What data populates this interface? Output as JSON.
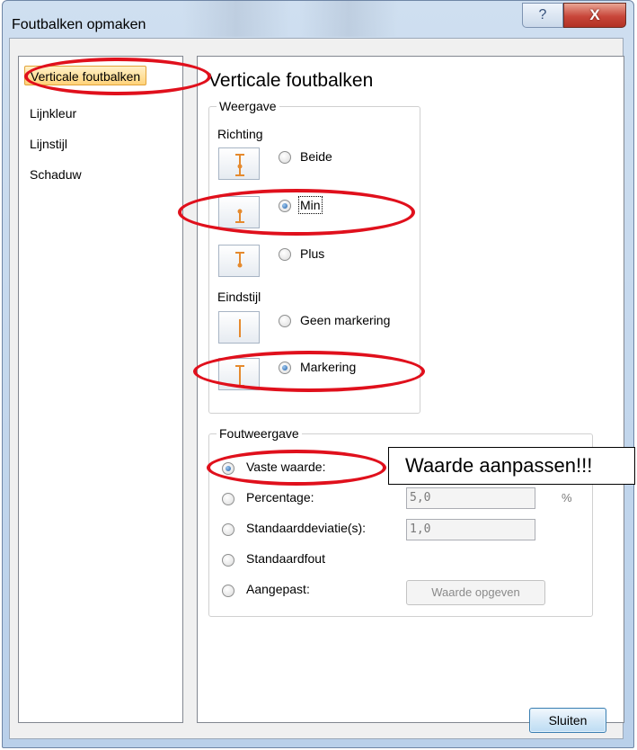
{
  "window": {
    "title": "Foutbalken opmaken",
    "help_label": "?",
    "close_label": "X",
    "colors": {
      "accent_annotation": "#e0101c",
      "nav_selected": "#ffd37a",
      "errorbar_icon": "#e58a2e"
    }
  },
  "sidebar": {
    "items": [
      {
        "label": "Verticale foutbalken",
        "selected": true
      },
      {
        "label": "Lijnkleur",
        "selected": false
      },
      {
        "label": "Lijnstijl",
        "selected": false
      },
      {
        "label": "Schaduw",
        "selected": false
      }
    ]
  },
  "main": {
    "heading": "Verticale foutbalken",
    "weergave": {
      "group_title": "Weergave",
      "richting_label": "Richting",
      "richting_options": [
        {
          "label": "Beide",
          "checked": false,
          "icon": "errorbar-both-icon"
        },
        {
          "label": "Min",
          "checked": true,
          "icon": "errorbar-minus-icon"
        },
        {
          "label": "Plus",
          "checked": false,
          "icon": "errorbar-plus-icon"
        }
      ],
      "eindstijl_label": "Eindstijl",
      "eindstijl_options": [
        {
          "label": "Geen markering",
          "checked": false,
          "icon": "errorbar-nocap-icon"
        },
        {
          "label": "Markering",
          "checked": true,
          "icon": "errorbar-cap-icon"
        }
      ]
    },
    "foutweergave": {
      "group_title": "Foutweergave",
      "options": [
        {
          "label": "Vaste waarde:",
          "checked": true
        },
        {
          "label": "Percentage:",
          "checked": false,
          "value": "5,0",
          "unit": "%"
        },
        {
          "label": "Standaarddeviatie(s):",
          "checked": false,
          "value": "1,0"
        },
        {
          "label": "Standaardfout",
          "checked": false
        },
        {
          "label": "Aangepast:",
          "checked": false
        }
      ],
      "specify_button_label": "Waarde opgeven"
    },
    "callout_text": "Waarde aanpassen!!!"
  },
  "footer": {
    "close_button_label": "Sluiten"
  }
}
